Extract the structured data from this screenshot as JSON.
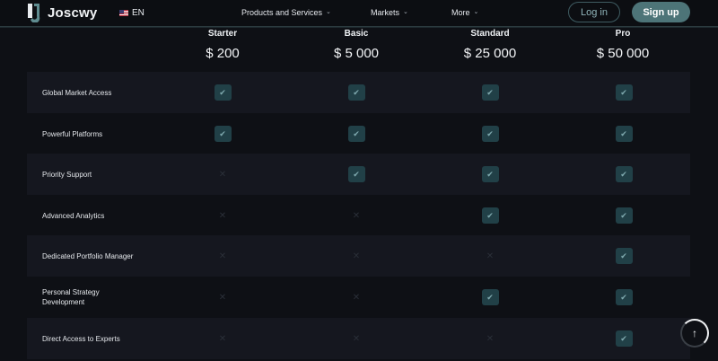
{
  "brand": {
    "name": "Joscwy"
  },
  "language": {
    "code": "EN",
    "flag_icon": "us-flag-icon"
  },
  "nav": [
    {
      "label": "Products and Services",
      "has_dropdown": true
    },
    {
      "label": "Markets",
      "has_dropdown": true
    },
    {
      "label": "More",
      "has_dropdown": true
    }
  ],
  "auth": {
    "login_label": "Log in",
    "signup_label": "Sign up"
  },
  "colors": {
    "accent": "#4d7478",
    "check_bg": "#214047",
    "background": "#0e1015"
  },
  "plans": [
    {
      "name": "Starter",
      "price": "$ 200"
    },
    {
      "name": "Basic",
      "price": "$ 5 000"
    },
    {
      "name": "Standard",
      "price": "$ 25 000"
    },
    {
      "name": "Pro",
      "price": "$ 50 000"
    }
  ],
  "features": [
    {
      "label": "Global Market Access",
      "included": [
        true,
        true,
        true,
        true
      ]
    },
    {
      "label": "Powerful Platforms",
      "included": [
        true,
        true,
        true,
        true
      ]
    },
    {
      "label": "Priority Support",
      "included": [
        false,
        true,
        true,
        true
      ]
    },
    {
      "label": "Advanced Analytics",
      "included": [
        false,
        false,
        true,
        true
      ]
    },
    {
      "label": "Dedicated Portfolio Manager",
      "included": [
        false,
        false,
        false,
        true
      ]
    },
    {
      "label": "Personal Strategy Development",
      "included": [
        false,
        false,
        true,
        true
      ]
    },
    {
      "label": "Direct Access to Experts",
      "included": [
        false,
        false,
        false,
        true
      ]
    }
  ],
  "icons": {
    "check": "check-icon",
    "cross": "cross-icon",
    "scroll_top": "arrow-up-icon"
  }
}
